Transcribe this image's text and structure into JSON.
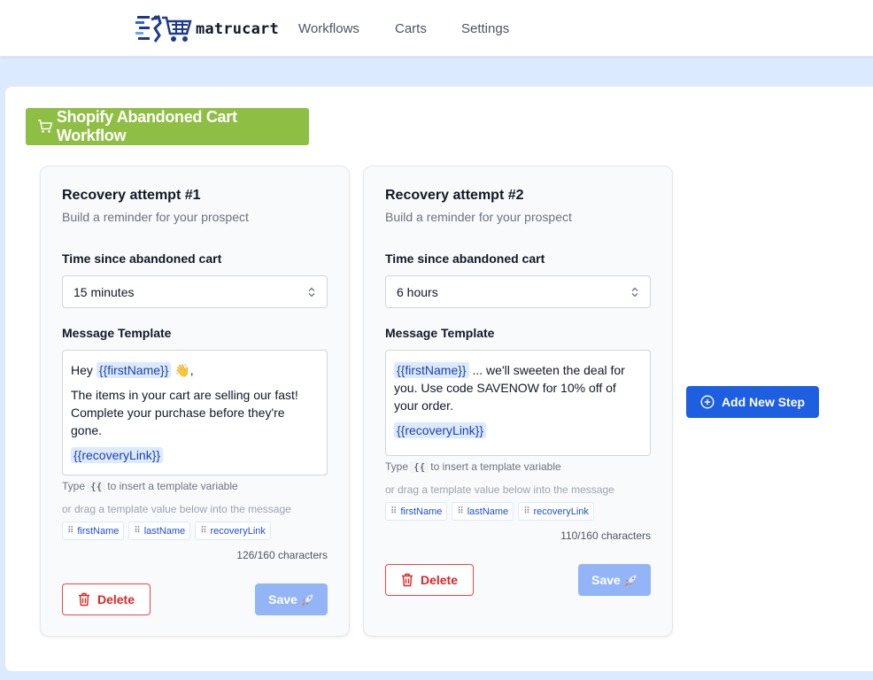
{
  "app": {
    "brand": "matrucart",
    "nav": [
      "Workflows",
      "Carts",
      "Settings"
    ]
  },
  "workflow": {
    "title": "Shopify Abandoned Cart Workflow"
  },
  "steps": [
    {
      "title": "Recovery attempt #1",
      "subtitle": "Build a reminder for your prospect",
      "time_label": "Time since abandoned cart",
      "time_value": "15 minutes",
      "message_label": "Message Template",
      "message": {
        "greeting": "Hey",
        "var_first": "{{firstName}}",
        "emoji": "👋,",
        "body": "The items in your cart are selling our fast! Complete your purchase before they're gone.",
        "var_link": "{{recoveryLink}}"
      },
      "hint_prefix": "Type",
      "hint_code": "{{",
      "hint_suffix": "to insert a template variable",
      "drag_hint": "or drag a template value below into the message",
      "chips": [
        "firstName",
        "lastName",
        "recoveryLink"
      ],
      "char_count": "126/160 characters",
      "delete_label": "Delete",
      "save_label": "Save"
    },
    {
      "title": "Recovery attempt #2",
      "subtitle": "Build a reminder for your prospect",
      "time_label": "Time since abandoned cart",
      "time_value": "6 hours",
      "message_label": "Message Template",
      "message": {
        "var_first": "{{firstName}}",
        "body": "... we'll sweeten the deal for you. Use code SAVENOW for 10% off of your order.",
        "var_link": "{{recoveryLink}}"
      },
      "hint_prefix": "Type",
      "hint_code": "{{",
      "hint_suffix": "to insert a template variable",
      "drag_hint": "or drag a template value below into the message",
      "chips": [
        "firstName",
        "lastName",
        "recoveryLink"
      ],
      "char_count": "110/160 characters",
      "delete_label": "Delete",
      "save_label": "Save"
    }
  ],
  "add_step_label": "Add New Step",
  "colors": {
    "brand_green": "#8fbe44",
    "primary_blue": "#1d5fe0",
    "danger_red": "#dc2626",
    "save_disabled": "#93b5f7"
  }
}
